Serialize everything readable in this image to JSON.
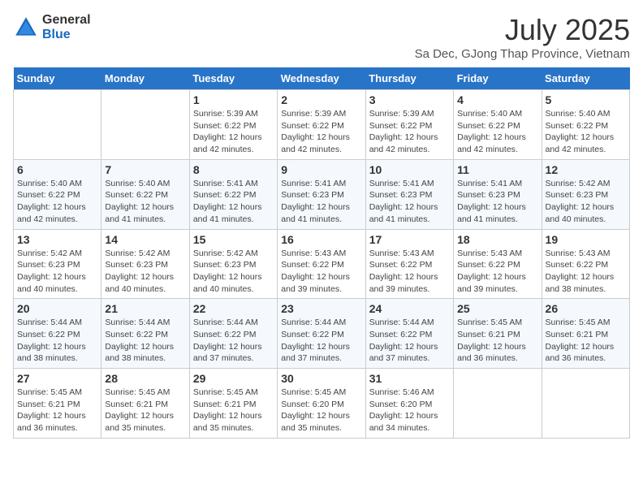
{
  "logo": {
    "general": "General",
    "blue": "Blue"
  },
  "title": "July 2025",
  "location": "Sa Dec, GJong Thap Province, Vietnam",
  "weekdays": [
    "Sunday",
    "Monday",
    "Tuesday",
    "Wednesday",
    "Thursday",
    "Friday",
    "Saturday"
  ],
  "weeks": [
    [
      {
        "day": "",
        "sunrise": "",
        "sunset": "",
        "daylight": ""
      },
      {
        "day": "",
        "sunrise": "",
        "sunset": "",
        "daylight": ""
      },
      {
        "day": "1",
        "sunrise": "Sunrise: 5:39 AM",
        "sunset": "Sunset: 6:22 PM",
        "daylight": "Daylight: 12 hours and 42 minutes."
      },
      {
        "day": "2",
        "sunrise": "Sunrise: 5:39 AM",
        "sunset": "Sunset: 6:22 PM",
        "daylight": "Daylight: 12 hours and 42 minutes."
      },
      {
        "day": "3",
        "sunrise": "Sunrise: 5:39 AM",
        "sunset": "Sunset: 6:22 PM",
        "daylight": "Daylight: 12 hours and 42 minutes."
      },
      {
        "day": "4",
        "sunrise": "Sunrise: 5:40 AM",
        "sunset": "Sunset: 6:22 PM",
        "daylight": "Daylight: 12 hours and 42 minutes."
      },
      {
        "day": "5",
        "sunrise": "Sunrise: 5:40 AM",
        "sunset": "Sunset: 6:22 PM",
        "daylight": "Daylight: 12 hours and 42 minutes."
      }
    ],
    [
      {
        "day": "6",
        "sunrise": "Sunrise: 5:40 AM",
        "sunset": "Sunset: 6:22 PM",
        "daylight": "Daylight: 12 hours and 42 minutes."
      },
      {
        "day": "7",
        "sunrise": "Sunrise: 5:40 AM",
        "sunset": "Sunset: 6:22 PM",
        "daylight": "Daylight: 12 hours and 41 minutes."
      },
      {
        "day": "8",
        "sunrise": "Sunrise: 5:41 AM",
        "sunset": "Sunset: 6:22 PM",
        "daylight": "Daylight: 12 hours and 41 minutes."
      },
      {
        "day": "9",
        "sunrise": "Sunrise: 5:41 AM",
        "sunset": "Sunset: 6:23 PM",
        "daylight": "Daylight: 12 hours and 41 minutes."
      },
      {
        "day": "10",
        "sunrise": "Sunrise: 5:41 AM",
        "sunset": "Sunset: 6:23 PM",
        "daylight": "Daylight: 12 hours and 41 minutes."
      },
      {
        "day": "11",
        "sunrise": "Sunrise: 5:41 AM",
        "sunset": "Sunset: 6:23 PM",
        "daylight": "Daylight: 12 hours and 41 minutes."
      },
      {
        "day": "12",
        "sunrise": "Sunrise: 5:42 AM",
        "sunset": "Sunset: 6:23 PM",
        "daylight": "Daylight: 12 hours and 40 minutes."
      }
    ],
    [
      {
        "day": "13",
        "sunrise": "Sunrise: 5:42 AM",
        "sunset": "Sunset: 6:23 PM",
        "daylight": "Daylight: 12 hours and 40 minutes."
      },
      {
        "day": "14",
        "sunrise": "Sunrise: 5:42 AM",
        "sunset": "Sunset: 6:23 PM",
        "daylight": "Daylight: 12 hours and 40 minutes."
      },
      {
        "day": "15",
        "sunrise": "Sunrise: 5:42 AM",
        "sunset": "Sunset: 6:23 PM",
        "daylight": "Daylight: 12 hours and 40 minutes."
      },
      {
        "day": "16",
        "sunrise": "Sunrise: 5:43 AM",
        "sunset": "Sunset: 6:22 PM",
        "daylight": "Daylight: 12 hours and 39 minutes."
      },
      {
        "day": "17",
        "sunrise": "Sunrise: 5:43 AM",
        "sunset": "Sunset: 6:22 PM",
        "daylight": "Daylight: 12 hours and 39 minutes."
      },
      {
        "day": "18",
        "sunrise": "Sunrise: 5:43 AM",
        "sunset": "Sunset: 6:22 PM",
        "daylight": "Daylight: 12 hours and 39 minutes."
      },
      {
        "day": "19",
        "sunrise": "Sunrise: 5:43 AM",
        "sunset": "Sunset: 6:22 PM",
        "daylight": "Daylight: 12 hours and 38 minutes."
      }
    ],
    [
      {
        "day": "20",
        "sunrise": "Sunrise: 5:44 AM",
        "sunset": "Sunset: 6:22 PM",
        "daylight": "Daylight: 12 hours and 38 minutes."
      },
      {
        "day": "21",
        "sunrise": "Sunrise: 5:44 AM",
        "sunset": "Sunset: 6:22 PM",
        "daylight": "Daylight: 12 hours and 38 minutes."
      },
      {
        "day": "22",
        "sunrise": "Sunrise: 5:44 AM",
        "sunset": "Sunset: 6:22 PM",
        "daylight": "Daylight: 12 hours and 37 minutes."
      },
      {
        "day": "23",
        "sunrise": "Sunrise: 5:44 AM",
        "sunset": "Sunset: 6:22 PM",
        "daylight": "Daylight: 12 hours and 37 minutes."
      },
      {
        "day": "24",
        "sunrise": "Sunrise: 5:44 AM",
        "sunset": "Sunset: 6:22 PM",
        "daylight": "Daylight: 12 hours and 37 minutes."
      },
      {
        "day": "25",
        "sunrise": "Sunrise: 5:45 AM",
        "sunset": "Sunset: 6:21 PM",
        "daylight": "Daylight: 12 hours and 36 minutes."
      },
      {
        "day": "26",
        "sunrise": "Sunrise: 5:45 AM",
        "sunset": "Sunset: 6:21 PM",
        "daylight": "Daylight: 12 hours and 36 minutes."
      }
    ],
    [
      {
        "day": "27",
        "sunrise": "Sunrise: 5:45 AM",
        "sunset": "Sunset: 6:21 PM",
        "daylight": "Daylight: 12 hours and 36 minutes."
      },
      {
        "day": "28",
        "sunrise": "Sunrise: 5:45 AM",
        "sunset": "Sunset: 6:21 PM",
        "daylight": "Daylight: 12 hours and 35 minutes."
      },
      {
        "day": "29",
        "sunrise": "Sunrise: 5:45 AM",
        "sunset": "Sunset: 6:21 PM",
        "daylight": "Daylight: 12 hours and 35 minutes."
      },
      {
        "day": "30",
        "sunrise": "Sunrise: 5:45 AM",
        "sunset": "Sunset: 6:20 PM",
        "daylight": "Daylight: 12 hours and 35 minutes."
      },
      {
        "day": "31",
        "sunrise": "Sunrise: 5:46 AM",
        "sunset": "Sunset: 6:20 PM",
        "daylight": "Daylight: 12 hours and 34 minutes."
      },
      {
        "day": "",
        "sunrise": "",
        "sunset": "",
        "daylight": ""
      },
      {
        "day": "",
        "sunrise": "",
        "sunset": "",
        "daylight": ""
      }
    ]
  ]
}
